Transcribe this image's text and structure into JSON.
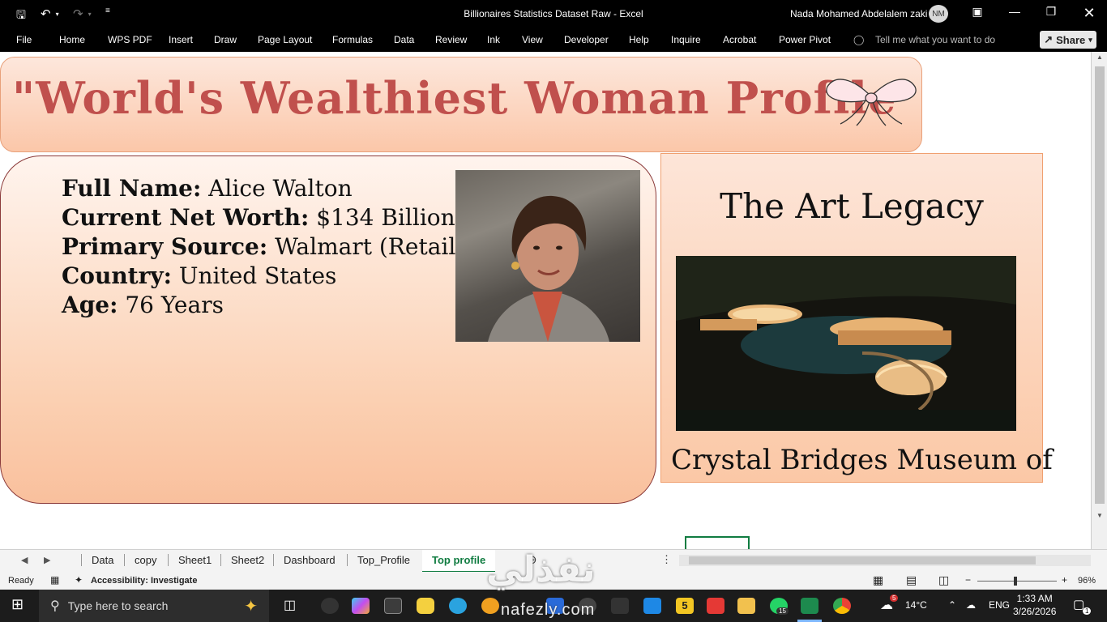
{
  "titlebar": {
    "document_title": "Billionaires Statistics Dataset Raw  -  Excel",
    "user_name": "Nada Mohamed Abdelalem zaki",
    "user_initials": "NM"
  },
  "ribbon": {
    "tabs": [
      "File",
      "Home",
      "WPS PDF",
      "Insert",
      "Draw",
      "Page Layout",
      "Formulas",
      "Data",
      "Review",
      "Ink",
      "View",
      "Developer",
      "Help",
      "Inquire",
      "Acrobat",
      "Power Pivot"
    ],
    "tell_me_placeholder": "Tell me what you want to do",
    "share_label": "Share"
  },
  "sheet": {
    "banner_title": "\"World's Wealthiest Woman Profile",
    "profile": {
      "full_name_label": "Full Name:",
      "full_name_value": " Alice Walton",
      "net_worth_label": "Current Net Worth:",
      "net_worth_value": " $134 Billion",
      "source_label": "Primary Source:",
      "source_value": " Walmart (Retail)",
      "country_label": "Country:",
      "country_value": " United States",
      "age_label": "Age:",
      "age_value": " 76 Years"
    },
    "art_title": "The Art Legacy",
    "art_caption": "Crystal Bridges Museum of"
  },
  "sheet_tabs": {
    "tabs": [
      "Data",
      "copy",
      "Sheet1",
      "Sheet2",
      "Dashboard",
      "Top_Profile",
      "Top profile"
    ],
    "active": "Top profile"
  },
  "status": {
    "mode": "Ready",
    "accessibility": "Accessibility: Investigate",
    "zoom": "96%"
  },
  "taskbar": {
    "search_placeholder": "Type here to search",
    "temperature": "14°C",
    "language": "ENG",
    "time": "1:33 AM",
    "date": "3/26/2026",
    "notification_count": "1",
    "badge_count": "15",
    "weather_badge": "5"
  },
  "watermark": {
    "arabic": "نفذلي",
    "latin": "nafezly.com"
  },
  "colors": {
    "title_red": "#c0504d",
    "excel_green": "#107c41",
    "peach": "#fbc8a6"
  }
}
